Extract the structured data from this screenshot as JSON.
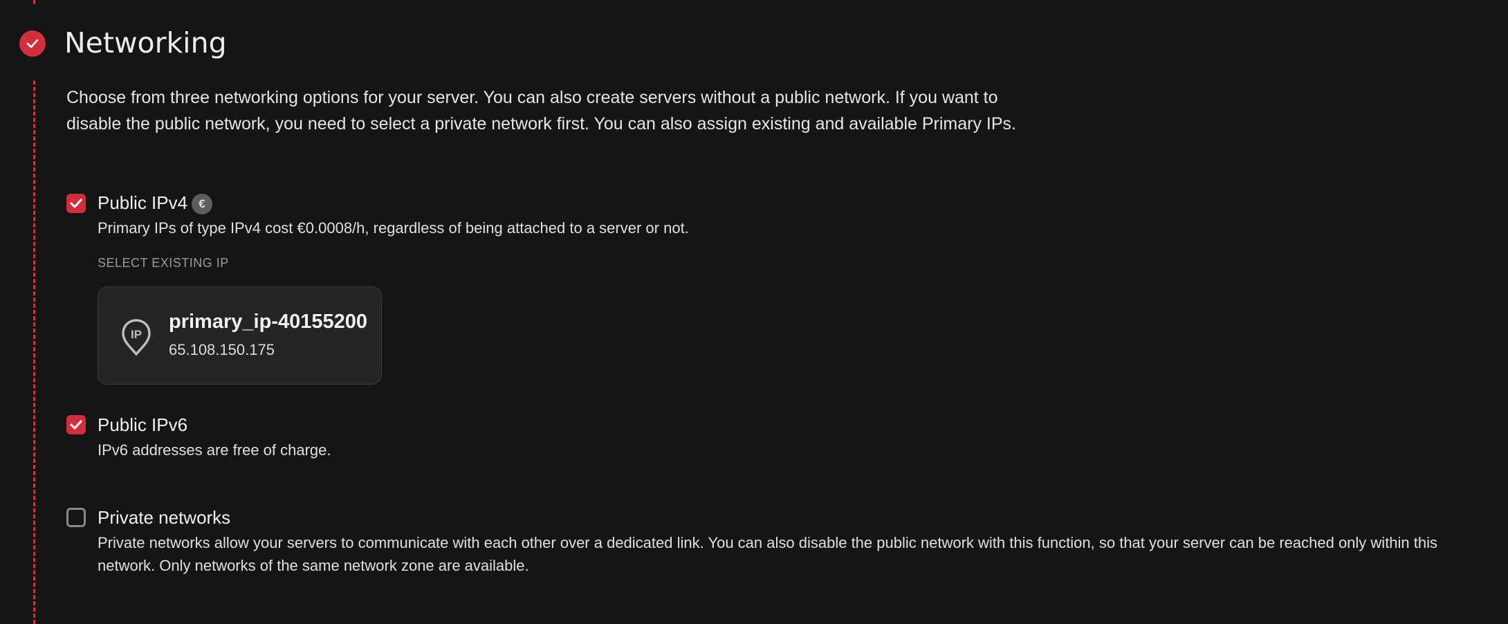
{
  "section": {
    "title": "Networking",
    "intro": "Choose from three networking options for your server. You can also create servers without a public network. If you want to disable the public network, you need to select a private network first. You can also assign existing and available Primary IPs.",
    "accent_color": "#d12f3c"
  },
  "options": {
    "ipv4": {
      "label": "Public IPv4",
      "checked": true,
      "badge": "€",
      "description": "Primary IPs of type IPv4 cost €0.0008/h, regardless of being attached to a server or not."
    },
    "select_existing_ip": {
      "label": "SELECT EXISTING IP",
      "card": {
        "icon_text": "IP",
        "name": "primary_ip-40155200",
        "address": "65.108.150.175"
      }
    },
    "ipv6": {
      "label": "Public IPv6",
      "checked": true,
      "description": "IPv6 addresses are free of charge."
    },
    "private": {
      "label": "Private networks",
      "checked": false,
      "description": "Private networks allow your servers to communicate with each other over a dedicated link. You can also disable the public network with this function, so that your server can be reached only within this network. Only networks of the same network zone are available."
    }
  }
}
